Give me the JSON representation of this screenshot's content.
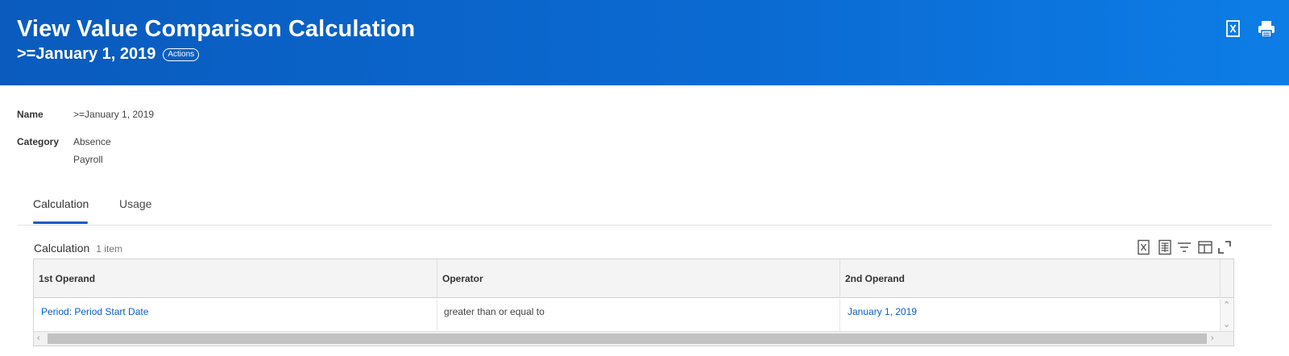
{
  "header": {
    "title": "View Value Comparison Calculation",
    "subtitle": ">=January 1, 2019",
    "actions_label": "Actions",
    "icons": [
      "excel-export-icon",
      "print-icon"
    ]
  },
  "fields": {
    "name_label": "Name",
    "name_value": ">=January 1, 2019",
    "category_label": "Category",
    "category_values": [
      "Absence",
      "Payroll"
    ]
  },
  "tabs": [
    {
      "label": "Calculation",
      "active": true
    },
    {
      "label": "Usage",
      "active": false
    }
  ],
  "grid": {
    "title": "Calculation",
    "count": "1 item",
    "toolbar_icons": [
      "excel-export-icon",
      "table-view-icon",
      "filter-icon",
      "columns-icon",
      "fullscreen-icon"
    ],
    "columns": [
      "1st Operand",
      "Operator",
      "2nd Operand"
    ],
    "rows": [
      {
        "first_operand": "Period: Period Start Date",
        "operator": "greater than or equal to",
        "second_operand": "January 1, 2019"
      }
    ]
  },
  "colors": {
    "header_bg": "#0b6bd3",
    "link": "#0b5cc5",
    "tab_active_underline": "#0b5cc5"
  }
}
